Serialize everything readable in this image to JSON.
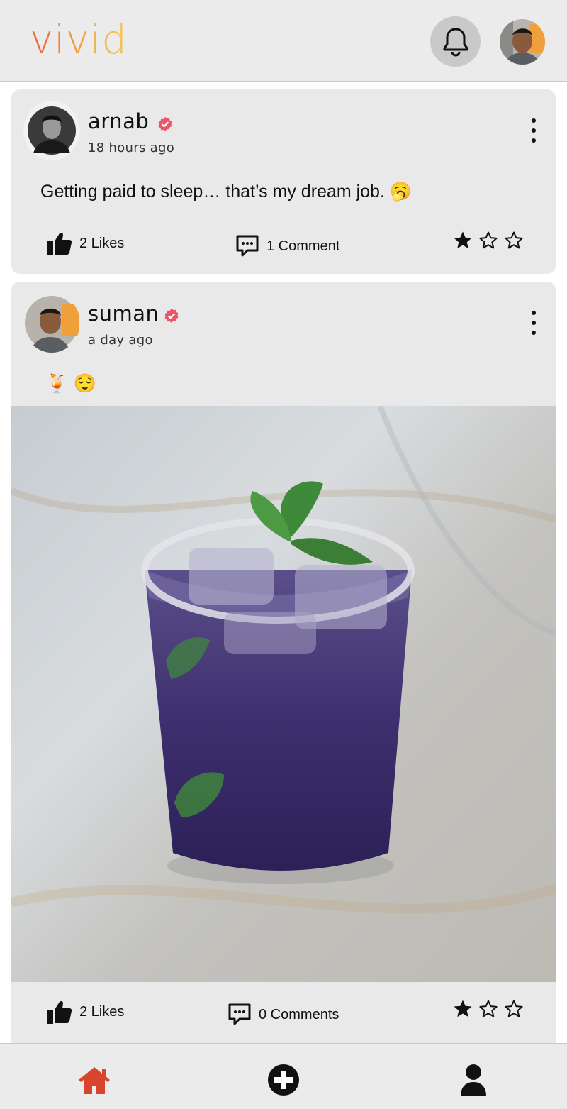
{
  "app": {
    "logo_text": "vivid"
  },
  "header": {
    "notifications_icon": "bell-icon",
    "profile_avatar": "user-avatar"
  },
  "posts": [
    {
      "username": "arnab",
      "verified": true,
      "time": "18 hours ago",
      "text": "Getting paid to sleep… that’s my dream job. 🥱",
      "likes_label": "2 Likes",
      "comments_label": "1 Comment",
      "rating": 1,
      "rating_max": 3
    },
    {
      "username": "suman",
      "verified": true,
      "time": "a day ago",
      "text": "🍹 😌",
      "image": "purple-drink-with-mint-photo",
      "likes_label": "2 Likes",
      "comments_label": "0 Comments",
      "rating": 1,
      "rating_max": 3
    }
  ],
  "bottom_nav": {
    "items": [
      {
        "icon": "home-icon",
        "active": true
      },
      {
        "icon": "add-post-icon",
        "active": false
      },
      {
        "icon": "profile-icon",
        "active": false
      }
    ]
  },
  "colors": {
    "logo_gradient_start": "#e8643b",
    "logo_gradient_end": "#f5c857",
    "verified": "#e8566a",
    "home_active": "#d9442c",
    "card_bg": "#e9e9e9",
    "header_bg": "#ebebeb"
  }
}
